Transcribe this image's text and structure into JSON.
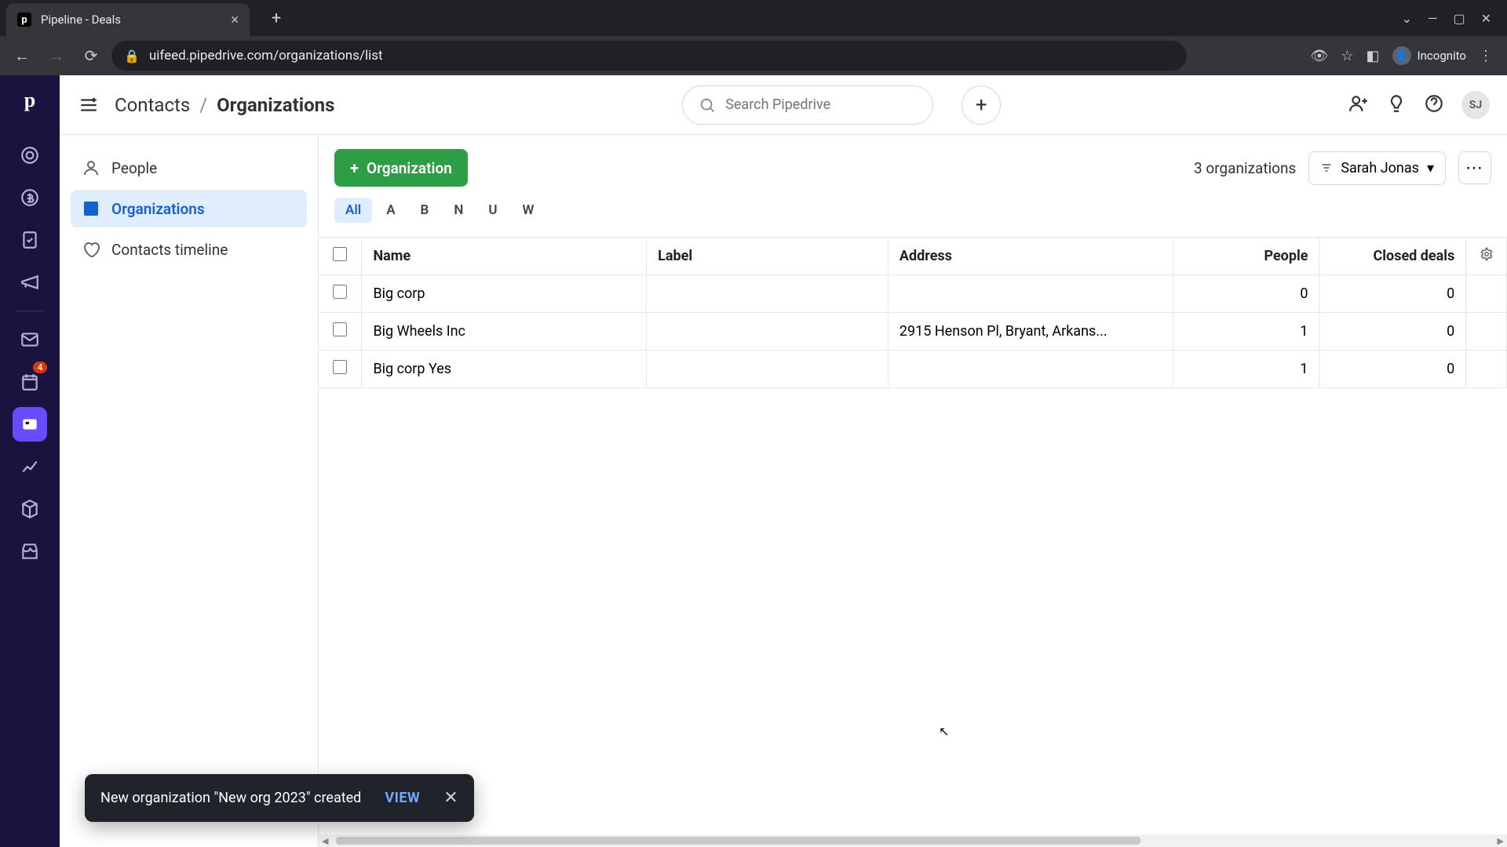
{
  "browser": {
    "tab_title": "Pipeline - Deals",
    "url": "uifeed.pipedrive.com/organizations/list",
    "incognito_label": "Incognito"
  },
  "rail": {
    "badge_count": "4"
  },
  "topbar": {
    "breadcrumb_root": "Contacts",
    "breadcrumb_current": "Organizations",
    "search_placeholder": "Search Pipedrive",
    "avatar_initials": "SJ"
  },
  "sidebar": {
    "items": [
      {
        "label": "People"
      },
      {
        "label": "Organizations"
      },
      {
        "label": "Contacts timeline"
      }
    ]
  },
  "toolbar": {
    "add_button": "Organization",
    "count_text": "3 organizations",
    "filter_user": "Sarah Jonas"
  },
  "alpha_tabs": [
    "All",
    "A",
    "B",
    "N",
    "U",
    "W"
  ],
  "table": {
    "columns": [
      "Name",
      "Label",
      "Address",
      "People",
      "Closed deals"
    ],
    "rows": [
      {
        "name": "Big corp",
        "label": "",
        "address": "",
        "people": "0",
        "closed": "0"
      },
      {
        "name": "Big Wheels Inc",
        "label": "",
        "address": "2915 Henson Pl, Bryant, Arkans...",
        "people": "1",
        "closed": "0"
      },
      {
        "name": "Big corp Yes",
        "label": "",
        "address": "",
        "people": "1",
        "closed": "0"
      }
    ]
  },
  "toast": {
    "message": "New organization \"New org 2023\" created",
    "action": "VIEW"
  }
}
